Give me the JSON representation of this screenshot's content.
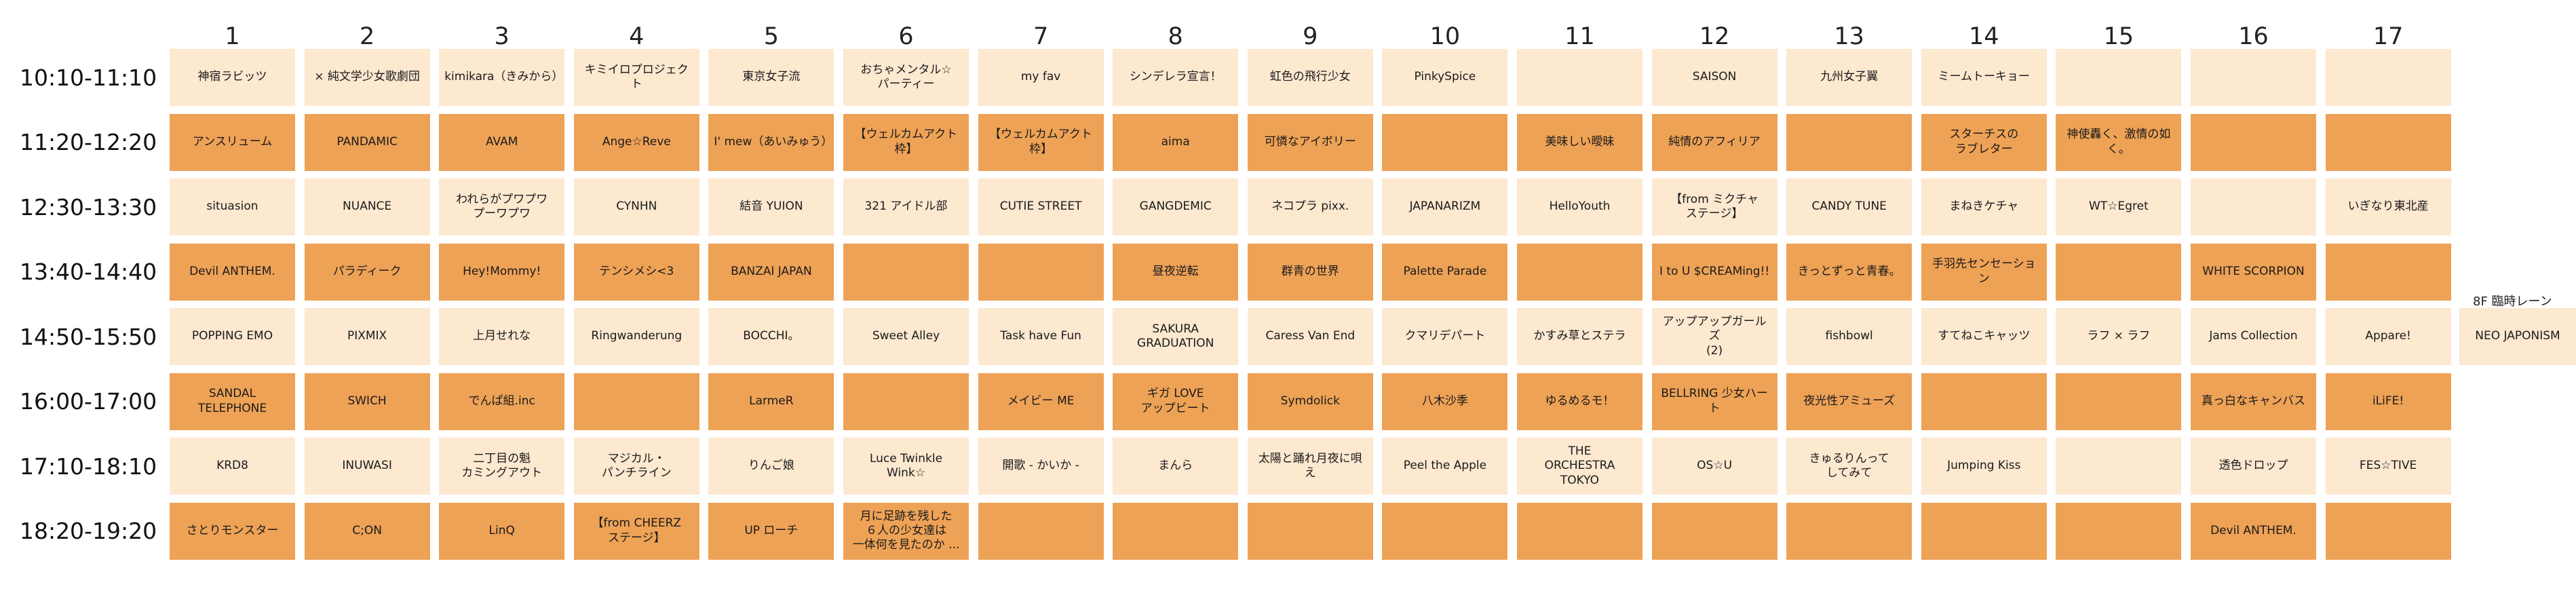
{
  "columns": [
    "1",
    "2",
    "3",
    "4",
    "5",
    "6",
    "7",
    "8",
    "9",
    "10",
    "11",
    "12",
    "13",
    "14",
    "15",
    "16",
    "17"
  ],
  "rows": [
    {
      "time": "10:10-11:10",
      "cells": [
        "神宿ラビッツ",
        "× 純文学少女歌劇団",
        "kimikara（きみから）",
        "キミイロプロジェクト",
        "東京女子流",
        "おちゃメンタル☆\nパーティー",
        "my fav",
        "シンデレラ宣言！",
        "虹色の飛行少女",
        "PinkySpice",
        "",
        "SAISON",
        "九州女子翼",
        "ミームトーキョー",
        "",
        "",
        ""
      ]
    },
    {
      "time": "11:20-12:20",
      "cells": [
        "アンスリューム",
        "PANDAMIC",
        "AVAM",
        "Ange☆Reve",
        "I' mew（あいみゅう）",
        "【ウェルカムアクト枠】",
        "【ウェルカムアクト枠】",
        "aima",
        "可憐なアイボリー",
        "",
        "美味しい曖昧",
        "純情のアフィリア",
        "",
        "スターチスの\nラブレター",
        "神使轟く、激情の如く。",
        "",
        ""
      ]
    },
    {
      "time": "12:30-13:30",
      "cells": [
        "situasion",
        "NUANCE",
        "われらがプワプワ\nプーワプワ",
        "CYNHN",
        "結音 YUION",
        "321 アイドル部",
        "CUTIE STREET",
        "GANGDEMIC",
        "ネコプラ pixx.",
        "JAPANARIZM",
        "HelloYouth",
        "【from ミクチャ\nステージ】",
        "CANDY TUNE",
        "まねきケチャ",
        "WT☆Egret",
        "",
        "いぎなり東北産"
      ]
    },
    {
      "time": "13:40-14:40",
      "cells": [
        "Devil ANTHEM.",
        "パラディーク",
        "Hey!Mommy!",
        "テンシメシ<3",
        "BANZAI JAPAN",
        "",
        "",
        "昼夜逆転",
        "群青の世界",
        "Palette Parade",
        "",
        "I to U $CREAMing!!",
        "きっとずっと青春。",
        "手羽先センセーション",
        "",
        "WHITE SCORPION",
        ""
      ]
    },
    {
      "time": "14:50-15:50",
      "cells": [
        "POPPING EMO",
        "PIXMIX",
        "上月せれな",
        "Ringwanderung",
        "BOCCHI。",
        "Sweet Alley",
        "Task have Fun",
        "SAKURA GRADUATION",
        "Caress Van End",
        "クマリデパート",
        "かすみ草とステラ",
        "アップアップガールズ\n(2)",
        "fishbowl",
        "すてねこキャッツ",
        "ラフ × ラフ",
        "Jams Collection",
        "Appare!"
      ]
    },
    {
      "time": "16:00-17:00",
      "cells": [
        "SANDAL TELEPHONE",
        "SWICH",
        "でんぱ組.inc",
        "",
        "LarmeR",
        "",
        "メイビー ME",
        "ギガ LOVE\nアップビート",
        "Symdolick",
        "八木沙季",
        "ゆるめるモ！",
        "BELLRING 少女ハート",
        "夜光性アミューズ",
        "",
        "",
        "真っ白なキャンバス",
        "iLiFE!"
      ]
    },
    {
      "time": "17:10-18:10",
      "cells": [
        "KRD8",
        "INUWASI",
        "二丁目の魁\nカミングアウト",
        "マジカル・\nパンチライン",
        "りんご娘",
        "Luce Twinkle Wink☆",
        "開歌 - かいか -",
        "まんら",
        "太陽と踊れ月夜に唄え",
        "Peel the Apple",
        "THE\nORCHESTRA\nTOKYO",
        "OS☆U",
        "きゅるりんって\nしてみて",
        "Jumping Kiss",
        "",
        "透色ドロップ",
        "FES☆TIVE"
      ]
    },
    {
      "time": "18:20-19:20",
      "cells": [
        "さとりモンスター",
        "C;ON",
        "LinQ",
        "【from CHEERZ\nステージ】",
        "UP ローチ",
        "月に足跡を残した\n６人の少女達は\n一体何を見たのか ...",
        "",
        "",
        "",
        "",
        "",
        "",
        "",
        "",
        "",
        "Devil ANTHEM.",
        ""
      ]
    }
  ],
  "extra": {
    "label": "8F 臨時レーン",
    "cell": "NEO JAPONISM"
  },
  "colors": {
    "light": "#fde8d0",
    "dark": "#eea256"
  }
}
